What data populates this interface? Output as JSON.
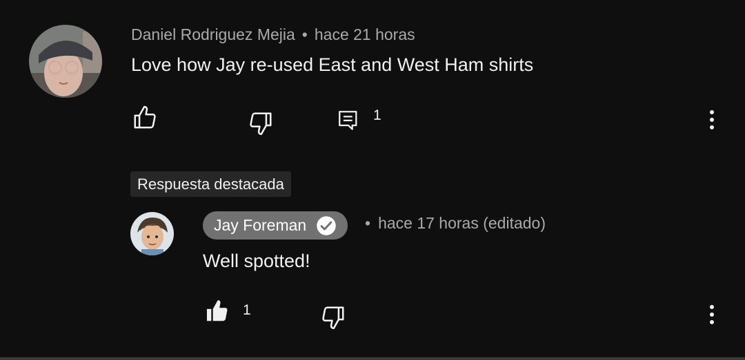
{
  "comment": {
    "author": "Daniel Rodriguez Mejia",
    "separator": "•",
    "time": "hace 21 horas",
    "text": "Love how Jay re-used East and West Ham shirts",
    "reply_count": "1",
    "icons": {
      "like": "thumbs-up-outline-icon",
      "dislike": "thumbs-down-outline-icon",
      "reply": "comment-icon",
      "more": "more-vert-icon"
    }
  },
  "highlighted_label": "Respuesta destacada",
  "reply": {
    "author": "Jay Foreman",
    "verified": true,
    "separator": "•",
    "time": "hace 17 horas (editado)",
    "text": "Well spotted!",
    "like_count": "1",
    "icons": {
      "like": "thumbs-up-filled-icon",
      "dislike": "thumbs-down-outline-icon",
      "verified": "verified-check-icon",
      "more": "more-vert-icon"
    }
  },
  "colors": {
    "background": "#0f0f0f",
    "text": "#f1f1f1",
    "meta": "#aaaaaa",
    "badge_bg": "#272727",
    "creator_pill": "#717171"
  }
}
